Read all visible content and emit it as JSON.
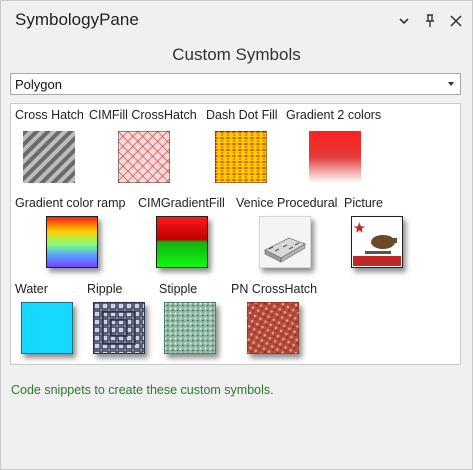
{
  "pane": {
    "title": "SymbologyPane",
    "subtitle": "Custom Symbols",
    "icons": [
      "chevron-down-icon",
      "pin-icon",
      "close-icon"
    ]
  },
  "geometry_select": {
    "value": "Polygon"
  },
  "symbols": [
    {
      "label": "Cross Hatch"
    },
    {
      "label": "CIMFill CrossHatch"
    },
    {
      "label": "Dash Dot Fill"
    },
    {
      "label": "Gradient 2 colors"
    },
    {
      "label": "Gradient color ramp"
    },
    {
      "label": "CIMGradientFill"
    },
    {
      "label": "Venice Procedural"
    },
    {
      "label": "Picture"
    },
    {
      "label": "Water"
    },
    {
      "label": "Ripple"
    },
    {
      "label": "Stipple"
    },
    {
      "label": "PN CrossHatch"
    }
  ],
  "footer": {
    "text": "Code snippets to create these custom symbols."
  },
  "colors": {
    "footer_text": "#2a7a2a",
    "water": "#16d9ff"
  }
}
